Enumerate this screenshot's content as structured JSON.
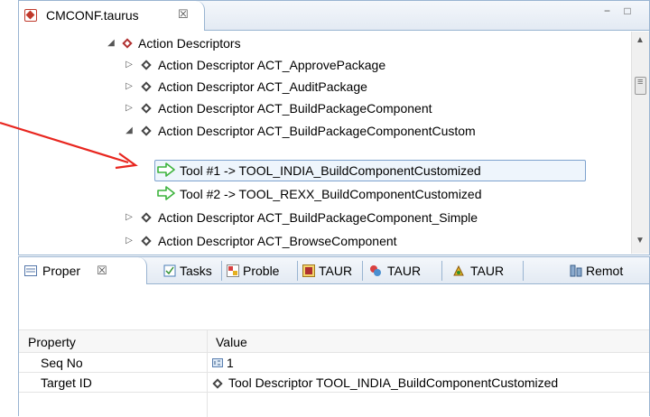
{
  "editor": {
    "tab_title": "CMCONF.taurus",
    "tab_close": "☒",
    "minmax": "▭▭"
  },
  "tree": {
    "root": {
      "label": "Action Descriptors",
      "expander": "◢"
    },
    "items": [
      {
        "label": "Action Descriptor ACT_ApprovePackage",
        "expander": "▷"
      },
      {
        "label": "Action Descriptor ACT_AuditPackage",
        "expander": "▷"
      },
      {
        "label": "Action Descriptor ACT_BuildPackageComponent",
        "expander": "▷"
      },
      {
        "label": "Action Descriptor ACT_BuildPackageComponentCustom",
        "expander": "◢"
      },
      {
        "label": "Tool #1 -> TOOL_INDIA_BuildComponentCustomized"
      },
      {
        "label": "Tool #2 -> TOOL_REXX_BuildComponentCustomized"
      },
      {
        "label": "Action Descriptor ACT_BuildPackageComponent_Simple",
        "expander": "▷"
      },
      {
        "label": "Action Descriptor ACT_BrowseComponent",
        "expander": "▷"
      }
    ],
    "scroll_up": "▲",
    "scroll_down": "▼"
  },
  "views": {
    "tabs": [
      {
        "label": "Proper",
        "close": "☒"
      },
      {
        "label": "Tasks"
      },
      {
        "label": "Proble"
      },
      {
        "label": "TAUR"
      },
      {
        "label": "TAUR"
      },
      {
        "label": "TAUR"
      },
      {
        "label": "Remot"
      }
    ]
  },
  "properties": {
    "header": {
      "property": "Property",
      "value": "Value"
    },
    "rows": [
      {
        "property": "Seq No",
        "value": "1"
      },
      {
        "property": "Target ID",
        "value": "Tool Descriptor TOOL_INDIA_BuildComponentCustomized"
      }
    ]
  },
  "colors": {
    "accent_border": "#99b4d1",
    "selection": "#eef5fc",
    "tool_arrow": "#3db33d",
    "callout_arrow": "#e8261f"
  }
}
